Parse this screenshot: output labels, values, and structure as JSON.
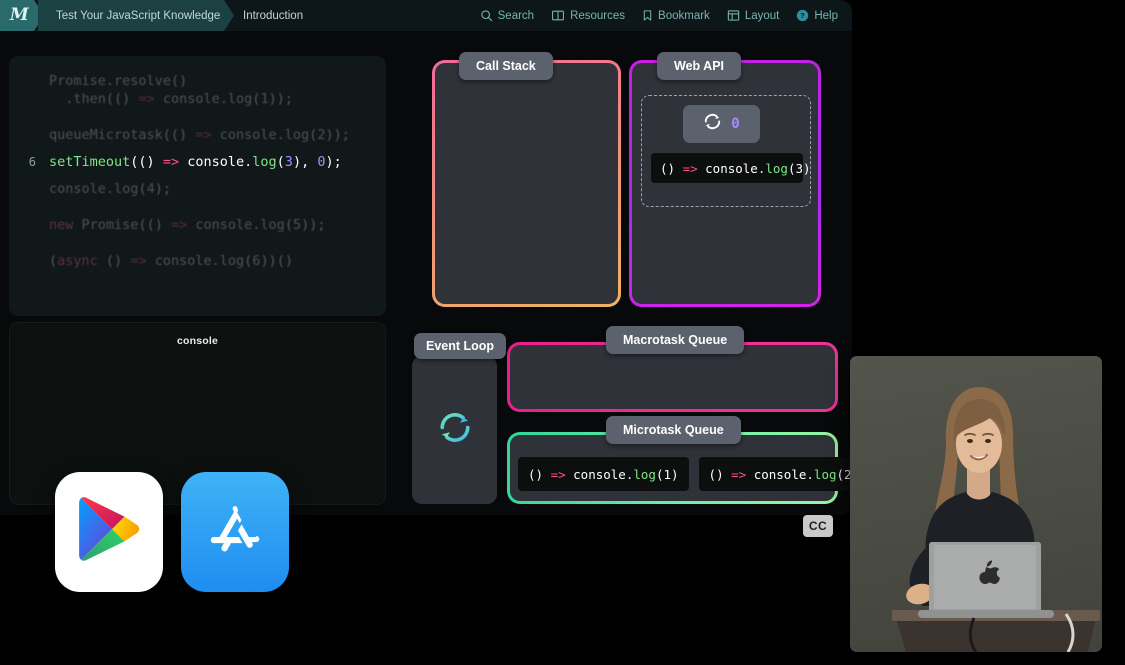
{
  "topbar": {
    "logo": "M",
    "breadcrumb": [
      {
        "label": "Test Your JavaScript Knowledge"
      },
      {
        "label": "Introduction"
      }
    ],
    "actions": [
      {
        "label": "Search",
        "icon": "search-icon"
      },
      {
        "label": "Resources",
        "icon": "book-icon"
      },
      {
        "label": "Bookmark",
        "icon": "bookmark-icon"
      },
      {
        "label": "Layout",
        "icon": "layout-icon"
      },
      {
        "label": "Help",
        "icon": "help-circle-icon"
      }
    ]
  },
  "editor": {
    "active_line_number": "6",
    "lines": [
      {
        "num": "",
        "text": "Promise.resolve()"
      },
      {
        "num": "",
        "text": "  .then(() => console.log(1));"
      },
      {
        "num": "",
        "text": ""
      },
      {
        "num": "",
        "text": "queueMicrotask(() => console.log(2));"
      },
      {
        "num": "6",
        "text": "setTimeout(() => console.log(3), 0);"
      },
      {
        "num": "",
        "text": "console.log(4);"
      },
      {
        "num": "",
        "text": ""
      },
      {
        "num": "",
        "text": "new Promise(() => console.log(5));"
      },
      {
        "num": "",
        "text": ""
      },
      {
        "num": "",
        "text": "(async () => console.log(6))()"
      }
    ]
  },
  "console": {
    "title": "console",
    "entries": []
  },
  "visualizer": {
    "call_stack": {
      "label": "Call Stack",
      "frames": []
    },
    "web_api": {
      "label": "Web API",
      "timer": {
        "icon": "loop-icon",
        "count": "0"
      },
      "tasks": [
        {
          "prefix": "() ",
          "arrow": "=> ",
          "obj": "console",
          "dot": ".",
          "method": "log",
          "open": "(",
          "arg": "3",
          "close": ")"
        }
      ]
    },
    "event_loop": {
      "label": "Event Loop",
      "icon": "loop-icon"
    },
    "macrotask_queue": {
      "label": "Macrotask Queue",
      "items": []
    },
    "microtask_queue": {
      "label": "Microtask Queue",
      "items": [
        {
          "prefix": "() ",
          "arrow": "=> ",
          "obj": "console",
          "dot": ".",
          "method": "log",
          "open": "(",
          "arg": "1",
          "close": ")"
        },
        {
          "prefix": "() ",
          "arrow": "=> ",
          "obj": "console",
          "dot": ".",
          "method": "log",
          "open": "(",
          "arg": "2",
          "close": ")"
        }
      ]
    }
  },
  "store_badges": [
    {
      "name": "google-play-badge",
      "icon": "google-play-icon"
    },
    {
      "name": "app-store-badge",
      "icon": "app-store-icon"
    }
  ],
  "video": {
    "caption_badge": "CC",
    "scene": "presenter-at-podium-with-laptop"
  },
  "colors": {
    "accent_teal": "#2a6a6c",
    "call_stack_start": "#f2699a",
    "call_stack_end": "#efb263",
    "web_api_start": "#c81fe0",
    "web_api_end": "#d522e8",
    "macrotask": "#e91e8c",
    "microtask": "#2fd69a",
    "panel_bg": "#2f3238",
    "label_bg": "#5b616d"
  }
}
